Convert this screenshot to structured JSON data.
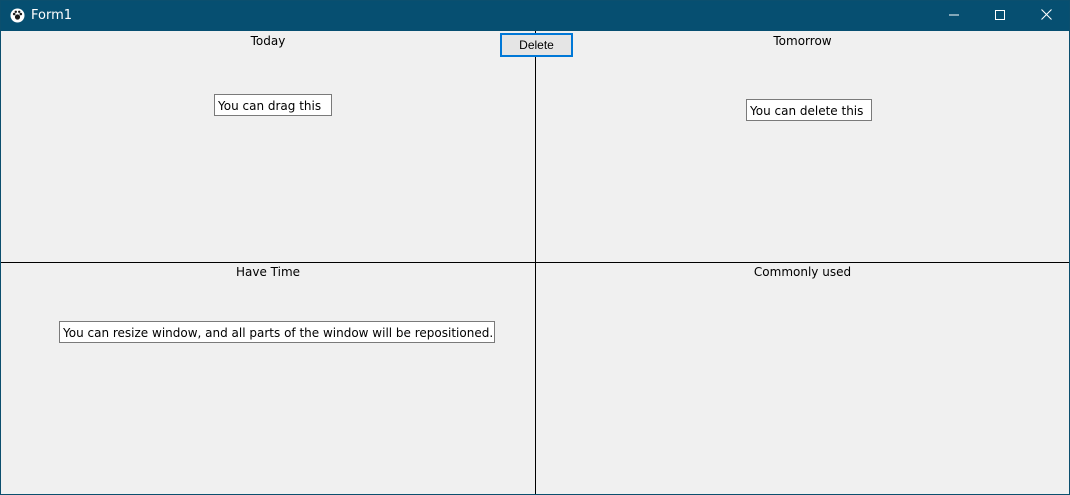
{
  "window": {
    "title": "Form1",
    "icon": "paw-icon",
    "controls": {
      "minimize": "minimize-icon",
      "maximize": "maximize-icon",
      "close": "close-icon"
    },
    "colors": {
      "titlebar": "#064f71",
      "client_background": "#f0f0f0",
      "button_focus_border": "#0078d7"
    }
  },
  "toolbar": {
    "delete_label": "Delete"
  },
  "panels": {
    "today": {
      "label": "Today",
      "items": [
        "You can drag this"
      ]
    },
    "tomorrow": {
      "label": "Tomorrow",
      "items": [
        "You can delete this"
      ]
    },
    "have_time": {
      "label": "Have Time",
      "items": [
        "You can resize window, and all parts of the window will be repositioned."
      ]
    },
    "commonly_used": {
      "label": "Commonly used",
      "items": []
    }
  }
}
